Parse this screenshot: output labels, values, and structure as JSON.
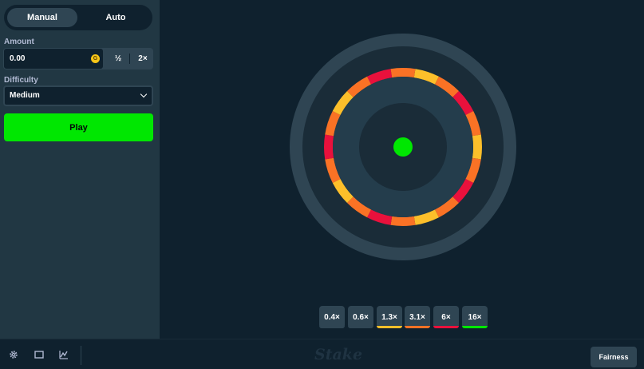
{
  "sidebar": {
    "tabs": [
      {
        "label": "Manual",
        "active": true
      },
      {
        "label": "Auto",
        "active": false
      }
    ],
    "amount": {
      "label": "Amount",
      "value": "0.00",
      "currency_icon": "gold-coin-icon",
      "currency_glyph": "G",
      "half_label": "½",
      "double_label": "2×"
    },
    "difficulty": {
      "label": "Difficulty",
      "selected": "Medium"
    },
    "play_label": "Play"
  },
  "wheel": {
    "segments": [
      "yellow",
      "orange",
      "red",
      "orange",
      "yellow",
      "orange",
      "red",
      "orange",
      "yellow",
      "orange",
      "red",
      "orange",
      "yellow",
      "orange",
      "red",
      "orange",
      "yellow",
      "orange",
      "red",
      "orange"
    ],
    "center_icon": "green-dot-icon"
  },
  "payouts": [
    {
      "label": "0.4×",
      "color": "#2f4553"
    },
    {
      "label": "0.6×",
      "color": "#2f4553"
    },
    {
      "label": "1.3×",
      "color": "#fdbf2a"
    },
    {
      "label": "3.1×",
      "color": "#fa7225"
    },
    {
      "label": "6×",
      "color": "#e9113c"
    },
    {
      "label": "16×",
      "color": "#00e701"
    }
  ],
  "colors": {
    "yellow": "#fdbf2a",
    "orange": "#fa7225",
    "red": "#e9113c",
    "green": "#00e701",
    "bg": "#0f212e",
    "panel": "#213743"
  },
  "footer": {
    "icons": [
      "gear-icon",
      "window-icon",
      "chart-icon"
    ],
    "logo": "Stake",
    "fairness_label": "Fairness"
  }
}
